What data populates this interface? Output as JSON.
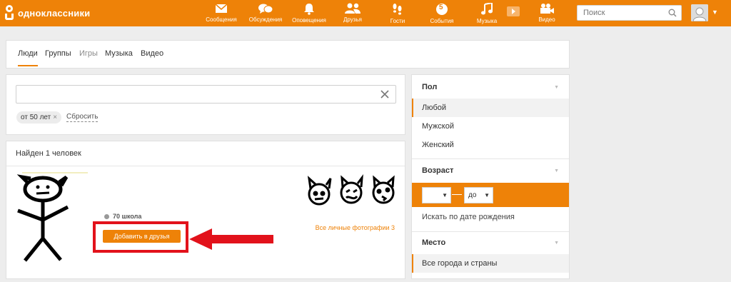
{
  "header": {
    "logo_text": "одноклассники",
    "nav": [
      {
        "label": "Сообщения",
        "icon": "envelope-icon"
      },
      {
        "label": "Обсуждения",
        "icon": "chat-bubbles-icon"
      },
      {
        "label": "Оповещения",
        "icon": "bell-icon"
      },
      {
        "label": "Друзья",
        "icon": "friends-icon"
      },
      {
        "label": "Гости",
        "icon": "footprints-icon"
      },
      {
        "label": "События",
        "icon": "events-icon",
        "badge": "5"
      },
      {
        "label": "Музыка",
        "icon": "music-note-icon"
      },
      {
        "label": "Видео",
        "icon": "video-camera-icon"
      }
    ],
    "search_placeholder": "Поиск"
  },
  "tabs": [
    {
      "label": "Люди",
      "active": true
    },
    {
      "label": "Группы",
      "active": false
    },
    {
      "label": "Игры",
      "active": false
    },
    {
      "label": "Музыка",
      "active": false
    },
    {
      "label": "Видео",
      "active": false
    }
  ],
  "filters": {
    "query_value": "",
    "chip_label": "от 50 лет",
    "chip_remove": "×",
    "reset_label": "Сбросить"
  },
  "results": {
    "found_text": "Найден 1 человек",
    "person": {
      "school": "70 школа",
      "add_button": "Добавить в друзья",
      "photos_link": "Все личные фотографии 3"
    }
  },
  "sidebar": {
    "gender": {
      "title": "Пол",
      "options": [
        "Любой",
        "Мужской",
        "Женский"
      ],
      "selected": "Любой"
    },
    "age": {
      "title": "Возраст",
      "from_value": "",
      "to_value": "до",
      "birthday_link": "Искать по дате рождения"
    },
    "place": {
      "title": "Место",
      "value": "Все города и страны"
    }
  },
  "colors": {
    "brand": "#ee8208",
    "highlight": "#e2121b"
  }
}
